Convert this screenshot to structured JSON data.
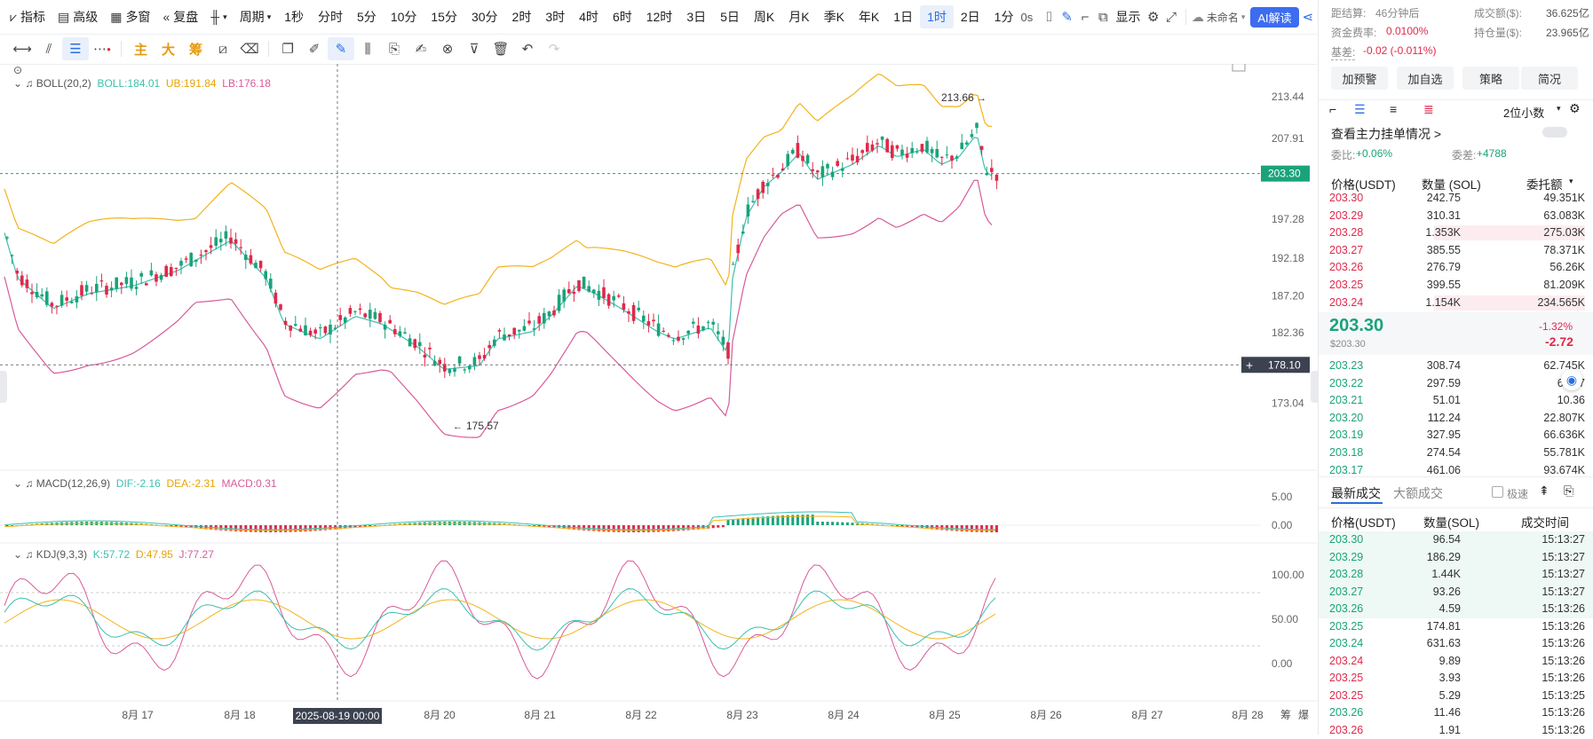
{
  "toolbar": {
    "items": [
      {
        "label": "指标",
        "icon": "chart-line-icon"
      },
      {
        "label": "高级",
        "icon": "calendar-icon"
      },
      {
        "label": "多窗",
        "icon": "grid-icon"
      },
      {
        "label": "复盘",
        "icon": "rewind-icon"
      }
    ],
    "chart_type_icon": "candlestick-type-icon",
    "period_label": "周期",
    "periods": [
      "1秒",
      "分时",
      "5分",
      "10分",
      "15分",
      "30分",
      "2时",
      "3时",
      "4时",
      "6时",
      "12时",
      "3日",
      "5日",
      "周K",
      "月K",
      "季K",
      "年K",
      "1日",
      "1时",
      "2日",
      "1分"
    ],
    "active_period": "1时",
    "countdown": "0s",
    "display_label": "显示",
    "cloud_label": "未命名",
    "ai_label": "AI解读"
  },
  "toolbar2": {
    "strategy_chars": [
      "主",
      "大",
      "筹"
    ]
  },
  "chart": {
    "legends": {
      "boll": {
        "name": "BOLL(20,2)",
        "boll": "BOLL:184.01",
        "ub": "UB:191.84",
        "lb": "LB:176.18"
      },
      "macd": {
        "name": "MACD(12,26,9)",
        "dif": "DIF:-2.16",
        "dea": "DEA:-2.31",
        "macd": "MACD:0.31"
      },
      "kdj": {
        "name": "KDJ(9,3,3)",
        "k": "K:57.72",
        "d": "D:47.95",
        "j": "J:77.27"
      }
    },
    "price_axis": [
      "213.44",
      "207.91",
      "197.28",
      "192.18",
      "187.20",
      "182.36",
      "173.04"
    ],
    "current_price_tag": "203.30",
    "crosshair_price_tag": "178.10",
    "high_label": "213.66",
    "low_label": "175.57",
    "macd_axis": [
      "5.00",
      "0.00"
    ],
    "kdj_axis": [
      "100.00",
      "50.00",
      "0.00"
    ],
    "date_axis": [
      "8月 17",
      "8月 18",
      "8月 20",
      "8月 21",
      "8月 22",
      "8月 23",
      "8月 24",
      "8月 25",
      "8月 26",
      "8月 27",
      "8月 28"
    ],
    "crosshair_time": "2025-08-19 00:00",
    "corner_labels": [
      "筹",
      "爆"
    ],
    "colors": {
      "up": "#1aa37a",
      "down": "#e0294a",
      "boll_mid": "#3cc0b0",
      "boll_ub": "#f2b31c",
      "boll_lb": "#d85a9a"
    }
  },
  "panel": {
    "settle_label": "距结算:",
    "settle_value": "46分钟后",
    "turnover_label": "成交额($):",
    "turnover_value": "36.625亿",
    "funding_label": "资金费率:",
    "funding_value": "0.0100%",
    "oi_label": "持仓量($):",
    "oi_value": "23.965亿",
    "basis_label": "基差:",
    "basis_value": "-0.02 (-0.011%)",
    "buttons": [
      "加预警",
      "加自选",
      "策略",
      "简况"
    ],
    "decimals": "2位小数",
    "mainforce_label": "查看主力挂单情况 >",
    "ratio_label": "委比:",
    "ratio_value": "+0.06%",
    "diff_label": "委差:",
    "diff_value": "+4788",
    "book_headers": [
      "价格(USDT)",
      "数量 (SOL)",
      "委托额"
    ],
    "asks": [
      [
        "203.30",
        "242.75",
        "49.351K"
      ],
      [
        "203.29",
        "310.31",
        "63.083K"
      ],
      [
        "203.28",
        "1.353K",
        "275.03K"
      ],
      [
        "203.27",
        "385.55",
        "78.371K"
      ],
      [
        "203.26",
        "276.79",
        "56.26K"
      ],
      [
        "203.25",
        "399.55",
        "81.209K"
      ],
      [
        "203.24",
        "1.154K",
        "234.565K"
      ]
    ],
    "last_price": "203.30",
    "last_usd": "$203.30",
    "change_pct": "-1.32%",
    "change_abs": "-2.72",
    "bids": [
      [
        "203.23",
        "308.74",
        "62.745K"
      ],
      [
        "203.22",
        "297.59",
        "60.47"
      ],
      [
        "203.21",
        "51.01",
        "10.36"
      ],
      [
        "203.20",
        "112.24",
        "22.807K"
      ],
      [
        "203.19",
        "327.95",
        "66.636K"
      ],
      [
        "203.18",
        "274.54",
        "55.781K"
      ],
      [
        "203.17",
        "461.06",
        "93.674K"
      ]
    ],
    "trades_tab": "最新成交",
    "big_trades_tab": "大额成交",
    "fast_label": "极速",
    "trade_headers": [
      "价格(USDT)",
      "数量(SOL)",
      "成交时间"
    ],
    "trades": [
      [
        "203.30",
        "96.54",
        "15:13:27",
        "g"
      ],
      [
        "203.29",
        "186.29",
        "15:13:27",
        "g"
      ],
      [
        "203.28",
        "1.44K",
        "15:13:27",
        "g"
      ],
      [
        "203.27",
        "93.26",
        "15:13:27",
        "g"
      ],
      [
        "203.26",
        "4.59",
        "15:13:26",
        "g"
      ],
      [
        "203.25",
        "174.81",
        "15:13:26",
        "g"
      ],
      [
        "203.24",
        "631.63",
        "15:13:26",
        "g"
      ],
      [
        "203.24",
        "9.89",
        "15:13:26",
        "r"
      ],
      [
        "203.25",
        "3.93",
        "15:13:26",
        "r"
      ],
      [
        "203.25",
        "5.29",
        "15:13:25",
        "r"
      ],
      [
        "203.26",
        "11.46",
        "15:13:26",
        "g"
      ],
      [
        "203.26",
        "1.91",
        "15:13:26",
        "r"
      ]
    ]
  }
}
